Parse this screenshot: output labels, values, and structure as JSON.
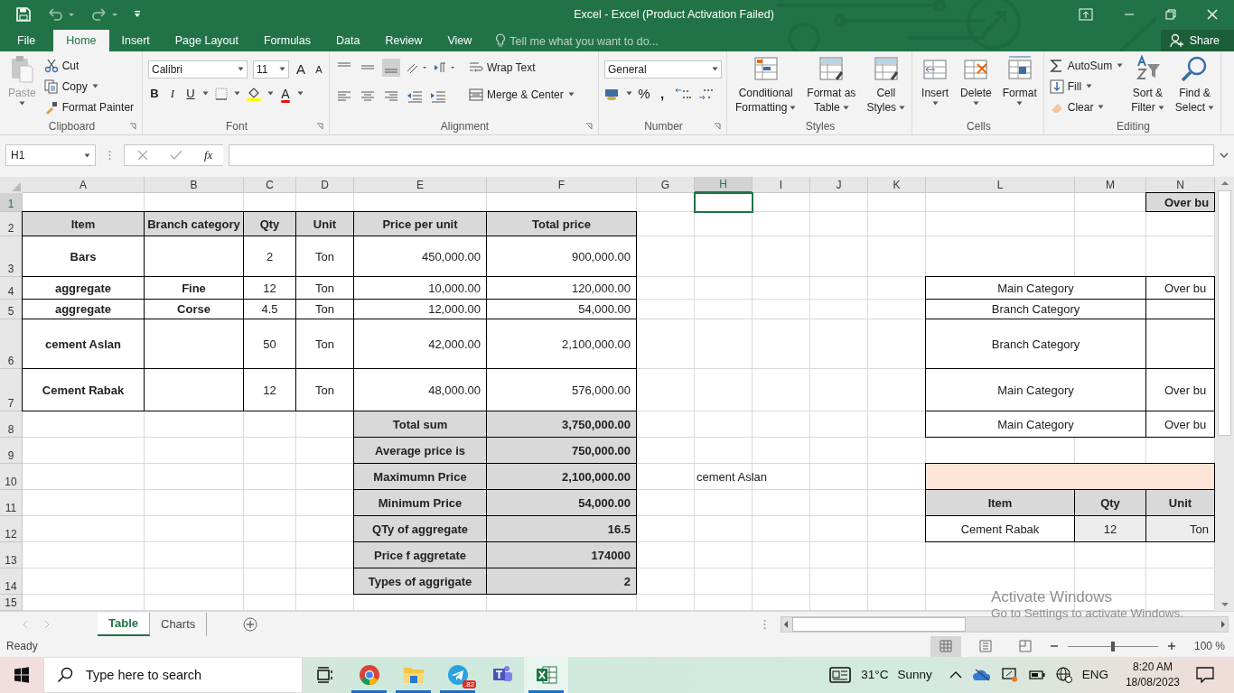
{
  "title_bar": {
    "title": "Excel - Excel (Product Activation Failed)"
  },
  "ribbon_tabs": [
    {
      "label": "File",
      "selected": false
    },
    {
      "label": "Home",
      "selected": true
    },
    {
      "label": "Insert",
      "selected": false
    },
    {
      "label": "Page Layout",
      "selected": false
    },
    {
      "label": "Formulas",
      "selected": false
    },
    {
      "label": "Data",
      "selected": false
    },
    {
      "label": "Review",
      "selected": false
    },
    {
      "label": "View",
      "selected": false
    }
  ],
  "tell_me": {
    "placeholder": "Tell me what you want to do..."
  },
  "share": "Share",
  "clipboard": {
    "label": "Clipboard",
    "paste": "Paste",
    "cut": "Cut",
    "copy": "Copy",
    "format_painter": "Format Painter"
  },
  "font": {
    "label": "Font",
    "family": "Calibri",
    "size": "11",
    "grow": "A",
    "shrink": "A",
    "bold": "B",
    "italic": "I",
    "underline": "U",
    "font_color_letter": "A"
  },
  "alignment": {
    "label": "Alignment",
    "wrap_text": "Wrap Text",
    "merge": "Merge & Center"
  },
  "number": {
    "label": "Number",
    "format": "General",
    "percent": "%",
    "comma": ","
  },
  "styles": {
    "label": "Styles",
    "buttons": [
      {
        "lines": [
          "Conditional",
          "Formatting"
        ]
      },
      {
        "lines": [
          "Format as",
          "Table"
        ]
      },
      {
        "lines": [
          "Cell",
          "Styles"
        ]
      }
    ]
  },
  "cells": {
    "label": "Cells",
    "buttons": [
      "Insert",
      "Delete",
      "Format"
    ]
  },
  "editing": {
    "label": "Editing",
    "autosum": "AutoSum",
    "fill": "Fill",
    "clear": "Clear",
    "sort": [
      "Sort &",
      "Filter"
    ],
    "find": [
      "Find &",
      "Select"
    ]
  },
  "formula_bar": {
    "name_box": "H1",
    "fx": "fx"
  },
  "sheet": {
    "columns": [
      {
        "label": "A",
        "selected": false
      },
      {
        "label": "B",
        "selected": false
      },
      {
        "label": "C",
        "selected": false
      },
      {
        "label": "D",
        "selected": false
      },
      {
        "label": "E",
        "selected": false
      },
      {
        "label": "F",
        "selected": false
      },
      {
        "label": "G",
        "selected": false
      },
      {
        "label": "H",
        "selected": true
      },
      {
        "label": "I",
        "selected": false
      },
      {
        "label": "J",
        "selected": false
      },
      {
        "label": "K",
        "selected": false
      },
      {
        "label": "L",
        "selected": false
      },
      {
        "label": "M",
        "selected": false
      },
      {
        "label": "N",
        "selected": false
      }
    ],
    "rows": [
      {
        "number": "1",
        "selected": true,
        "cells": [
          {
            "kind": "blank"
          },
          {
            "kind": "blank"
          },
          {
            "kind": "blank"
          },
          {
            "kind": "blank"
          },
          {
            "kind": "blank"
          },
          {
            "kind": "blank"
          },
          {
            "kind": "blank"
          },
          {
            "kind": "blank"
          },
          {
            "kind": "blank"
          },
          {
            "kind": "blank"
          },
          {
            "kind": "blank"
          },
          {
            "kind": "blank"
          },
          {
            "kind": "blank"
          },
          {
            "kind": "header_cut",
            "text": "Over bu"
          }
        ]
      },
      {
        "number": "2",
        "selected": false,
        "cells": [
          {
            "kind": "header",
            "text": "Item"
          },
          {
            "kind": "header",
            "text": "Branch category"
          },
          {
            "kind": "header",
            "text": "Qty"
          },
          {
            "kind": "header",
            "text": "Unit"
          },
          {
            "kind": "header",
            "text": "Price per unit"
          },
          {
            "kind": "header",
            "text": "Total price"
          }
        ]
      },
      {
        "number": "3",
        "selected": false,
        "cells": [
          {
            "kind": "bold",
            "text": "Bars"
          },
          {
            "kind": "boxed"
          },
          {
            "kind": "text",
            "text": "2"
          },
          {
            "kind": "text",
            "text": "Ton"
          },
          {
            "kind": "number",
            "text": "450,000.00"
          },
          {
            "kind": "number",
            "text": "900,000.00"
          }
        ]
      },
      {
        "number": "4",
        "selected": false,
        "cells": [
          {
            "kind": "bold",
            "text": "aggregate"
          },
          {
            "kind": "bold",
            "text": "Fine"
          },
          {
            "kind": "text",
            "text": "12"
          },
          {
            "kind": "text",
            "text": "Ton"
          },
          {
            "kind": "number",
            "text": "10,000.00"
          },
          {
            "kind": "number",
            "text": "120,000.00"
          },
          {
            "kind": "blank"
          },
          {
            "kind": "blank"
          },
          {
            "kind": "blank"
          },
          {
            "kind": "blank"
          },
          {
            "kind": "blank"
          },
          {
            "kind": "wide",
            "text": "Main Category"
          },
          {
            "kind": "covered"
          },
          {
            "kind": "cut",
            "text": "Over bu"
          }
        ]
      },
      {
        "number": "5",
        "selected": false,
        "cells": [
          {
            "kind": "bold",
            "text": "aggregate"
          },
          {
            "kind": "bold",
            "text": "Corse"
          },
          {
            "kind": "text",
            "text": "4.5"
          },
          {
            "kind": "text",
            "text": "Ton"
          },
          {
            "kind": "number",
            "text": "12,000.00"
          },
          {
            "kind": "number",
            "text": "54,000.00"
          },
          {
            "kind": "blank"
          },
          {
            "kind": "blank"
          },
          {
            "kind": "blank"
          },
          {
            "kind": "blank"
          },
          {
            "kind": "blank"
          },
          {
            "kind": "wide",
            "text": "Branch Category"
          },
          {
            "kind": "covered"
          },
          {
            "kind": "boxed"
          }
        ]
      },
      {
        "number": "6",
        "selected": false,
        "cells": [
          {
            "kind": "bold",
            "text": "cement Aslan"
          },
          {
            "kind": "boxed"
          },
          {
            "kind": "text",
            "text": "50"
          },
          {
            "kind": "text",
            "text": "Ton"
          },
          {
            "kind": "number",
            "text": "42,000.00"
          },
          {
            "kind": "number",
            "text": "2,100,000.00"
          },
          {
            "kind": "blank"
          },
          {
            "kind": "blank"
          },
          {
            "kind": "blank"
          },
          {
            "kind": "blank"
          },
          {
            "kind": "blank"
          },
          {
            "kind": "wide",
            "text": "Branch Category"
          },
          {
            "kind": "covered"
          },
          {
            "kind": "boxed"
          }
        ]
      },
      {
        "number": "7",
        "selected": false,
        "cells": [
          {
            "kind": "bold",
            "text": "Cement Rabak"
          },
          {
            "kind": "boxed"
          },
          {
            "kind": "text",
            "text": "12"
          },
          {
            "kind": "text",
            "text": "Ton"
          },
          {
            "kind": "number",
            "text": "48,000.00"
          },
          {
            "kind": "number",
            "text": "576,000.00"
          },
          {
            "kind": "blank"
          },
          {
            "kind": "blank"
          },
          {
            "kind": "blank"
          },
          {
            "kind": "blank"
          },
          {
            "kind": "blank"
          },
          {
            "kind": "wide",
            "text": "Main Category"
          },
          {
            "kind": "covered"
          },
          {
            "kind": "cut",
            "text": "Over bu"
          }
        ]
      },
      {
        "number": "8",
        "selected": false,
        "cells": [
          {
            "kind": "blank"
          },
          {
            "kind": "blank"
          },
          {
            "kind": "blank"
          },
          {
            "kind": "blank"
          },
          {
            "kind": "summary",
            "text": "Total sum"
          },
          {
            "kind": "summary_number",
            "text": "3,750,000.00"
          },
          {
            "kind": "blank"
          },
          {
            "kind": "blank"
          },
          {
            "kind": "blank"
          },
          {
            "kind": "blank"
          },
          {
            "kind": "blank"
          },
          {
            "kind": "wide",
            "text": "Main Category"
          },
          {
            "kind": "covered"
          },
          {
            "kind": "cut",
            "text": "Over bu"
          }
        ]
      },
      {
        "number": "9",
        "selected": false,
        "cells": [
          {
            "kind": "blank"
          },
          {
            "kind": "blank"
          },
          {
            "kind": "blank"
          },
          {
            "kind": "blank"
          },
          {
            "kind": "summary",
            "text": "Average price is"
          },
          {
            "kind": "summary_number",
            "text": "750,000.00"
          }
        ]
      },
      {
        "number": "10",
        "selected": false,
        "cells": [
          {
            "kind": "blank"
          },
          {
            "kind": "blank"
          },
          {
            "kind": "blank"
          },
          {
            "kind": "blank"
          },
          {
            "kind": "summary",
            "text": "Maximumn Price"
          },
          {
            "kind": "summary_number",
            "text": "2,100,000.00"
          },
          {
            "kind": "blank"
          },
          {
            "kind": "free",
            "text": "cement Aslan"
          },
          {
            "kind": "blank"
          },
          {
            "kind": "blank"
          },
          {
            "kind": "blank"
          },
          {
            "kind": "band"
          },
          {
            "kind": "covered"
          },
          {
            "kind": "covered"
          }
        ]
      },
      {
        "number": "11",
        "selected": false,
        "cells": [
          {
            "kind": "blank"
          },
          {
            "kind": "blank"
          },
          {
            "kind": "blank"
          },
          {
            "kind": "blank"
          },
          {
            "kind": "summary",
            "text": "Minimum Price"
          },
          {
            "kind": "summary_number",
            "text": "54,000.00"
          },
          {
            "kind": "blank"
          },
          {
            "kind": "blank"
          },
          {
            "kind": "blank"
          },
          {
            "kind": "blank"
          },
          {
            "kind": "blank"
          },
          {
            "kind": "header",
            "text": "Item"
          },
          {
            "kind": "header",
            "text": "Qty"
          },
          {
            "kind": "header",
            "text": "Unit"
          }
        ]
      },
      {
        "number": "12",
        "selected": false,
        "cells": [
          {
            "kind": "blank"
          },
          {
            "kind": "blank"
          },
          {
            "kind": "blank"
          },
          {
            "kind": "blank"
          },
          {
            "kind": "summary",
            "text": "QTy of aggregate"
          },
          {
            "kind": "summary_number",
            "text": "16.5"
          },
          {
            "kind": "blank"
          },
          {
            "kind": "blank"
          },
          {
            "kind": "blank"
          },
          {
            "kind": "blank"
          },
          {
            "kind": "blank"
          },
          {
            "kind": "text",
            "text": "Cement Rabak"
          },
          {
            "kind": "light",
            "text": "12"
          },
          {
            "kind": "light_number",
            "text": "Ton"
          }
        ]
      },
      {
        "number": "13",
        "selected": false,
        "cells": [
          {
            "kind": "blank"
          },
          {
            "kind": "blank"
          },
          {
            "kind": "blank"
          },
          {
            "kind": "blank"
          },
          {
            "kind": "summary",
            "text": "Price f aggretate"
          },
          {
            "kind": "summary_number",
            "text": "174000"
          }
        ]
      },
      {
        "number": "14",
        "selected": false,
        "cells": [
          {
            "kind": "blank"
          },
          {
            "kind": "blank"
          },
          {
            "kind": "blank"
          },
          {
            "kind": "blank"
          },
          {
            "kind": "summary",
            "text": "Types of aggrigate"
          },
          {
            "kind": "summary_number",
            "text": "2"
          }
        ]
      },
      {
        "number": "15",
        "selected": false,
        "cells": []
      }
    ]
  },
  "sheet_tabs": [
    {
      "label": "Table",
      "selected": true
    },
    {
      "label": "Charts",
      "selected": false
    }
  ],
  "activation": {
    "title": "Activate Windows",
    "text": "Go to Settings to activate Windows."
  },
  "status_bar": {
    "status": "Ready",
    "zoom": "100 %",
    "zoom_level": {
      "level": 0.5
    }
  },
  "taskbar": {
    "search": {
      "placeholder": "Type here to search"
    },
    "apps": [
      {
        "kind": "task-view",
        "running": false,
        "selected": false
      },
      {
        "kind": "browser",
        "running": true,
        "selected": false
      },
      {
        "kind": "files",
        "running": true,
        "selected": false
      },
      {
        "kind": "telegram",
        "running": true,
        "selected": false,
        "badge": ".82"
      },
      {
        "kind": "teams",
        "running": false,
        "selected": false
      },
      {
        "kind": "excel",
        "running": true,
        "selected": true
      }
    ],
    "temperature": "31°C",
    "weather": "Sunny",
    "language": "ENG",
    "time": "8:20 AM",
    "date": "18/08/2023"
  }
}
